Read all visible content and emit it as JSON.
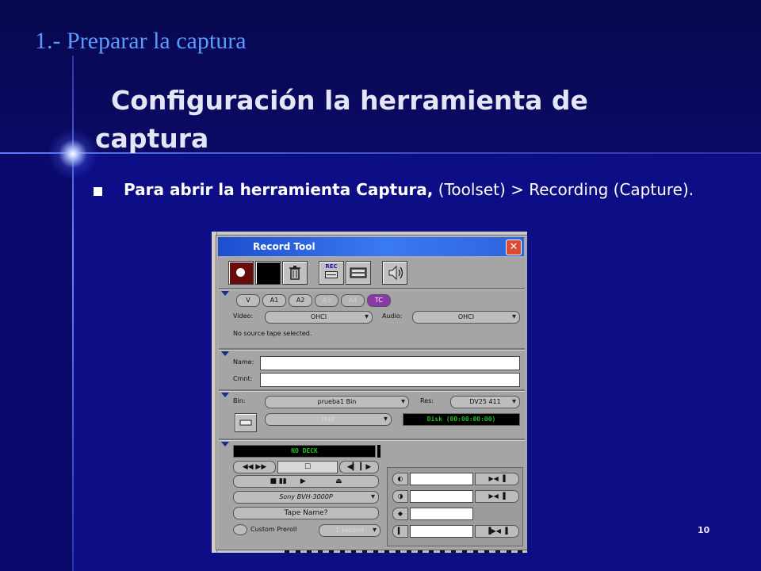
{
  "slide": {
    "section_title": "1.- Preparar la captura",
    "main_title": "Configuración la herramienta de captura",
    "bullet_bold": "Para abrir la herramienta Captura,",
    "bullet_rest": " (Toolset) > Recording (Capture).",
    "page_number": "10"
  },
  "record_tool": {
    "title": "Record Tool",
    "close": "✕",
    "tracks": [
      "V",
      "A1",
      "A2",
      "A3",
      "A4",
      "TC"
    ],
    "video_label": "Video:",
    "video_value": "OHCI",
    "audio_label": "Audio:",
    "audio_value": "OHCI",
    "source_status": "No source tape selected.",
    "name_label": "Name:",
    "name_value": "",
    "cmnt_label": "Cmnt:",
    "cmnt_value": "",
    "bin_label": "Bin:",
    "bin_value": "prueba1 Bin",
    "res_label": "Res:",
    "res_value": "DV25 411",
    "target_drive": "Hdd",
    "disk_readout": "Disk (00:00:00:00)",
    "deck_readout": "NO DECK",
    "deck_model": "Sony BVH-3000P",
    "tape_name": "Tape Name?",
    "custom_preroll_label": "Custom Preroll",
    "preroll_value": "1 second",
    "rec_icon_text": "REC"
  },
  "icons": {
    "record": "record-icon",
    "trash": "trash-icon",
    "speaker": "speaker-icon"
  }
}
